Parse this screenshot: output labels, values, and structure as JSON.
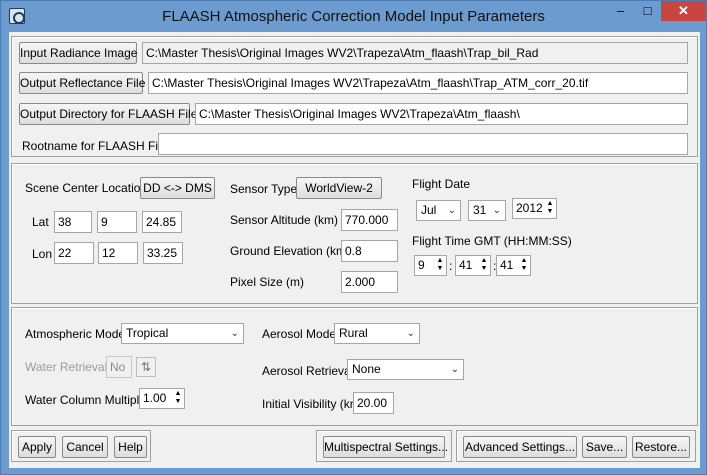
{
  "window": {
    "title": "FLAASH Atmospheric Correction Model Input Parameters",
    "minimize": "–",
    "maximize": "□",
    "close": "✕"
  },
  "files": {
    "input_radiance_label": "Input Radiance Image",
    "input_radiance_value": "C:\\Master Thesis\\Original Images WV2\\Trapeza\\Atm_flaash\\Trap_bil_Rad",
    "output_reflectance_label": "Output Reflectance File",
    "output_reflectance_value": "C:\\Master Thesis\\Original Images WV2\\Trapeza\\Atm_flaash\\Trap_ATM_corr_20.tif",
    "output_directory_label": "Output Directory for FLAASH Files",
    "output_directory_value": "C:\\Master Thesis\\Original Images WV2\\Trapeza\\Atm_flaash\\",
    "rootname_label": "Rootname for FLAASH Files",
    "rootname_value": ""
  },
  "scene": {
    "center_label": "Scene Center Location",
    "dd_dms_button": "DD <-> DMS",
    "lat_label": "Lat",
    "lat_deg": "38",
    "lat_min": "9",
    "lat_sec": "24.85",
    "lon_label": "Lon",
    "lon_deg": "22",
    "lon_min": "12",
    "lon_sec": "33.25"
  },
  "sensor": {
    "type_label": "Sensor Type",
    "type_value": "WorldView-2",
    "altitude_label": "Sensor Altitude (km)",
    "altitude_value": "770.000",
    "ground_elev_label": "Ground Elevation (km)",
    "ground_elev_value": "0.8",
    "pixel_size_label": "Pixel Size (m)",
    "pixel_size_value": "2.000"
  },
  "flight": {
    "date_label": "Flight Date",
    "month": "Jul",
    "day": "31",
    "year": "2012",
    "time_label": "Flight Time GMT (HH:MM:SS)",
    "hh": "9",
    "mm": "41",
    "ss": "41",
    "sep": ":"
  },
  "atmosphere": {
    "model_label": "Atmospheric Model",
    "model_value": "Tropical",
    "water_retrieval_label": "Water Retrieval",
    "water_retrieval_value": "No",
    "water_column_label": "Water Column Multiplier",
    "water_column_value": "1.00",
    "aerosol_model_label": "Aerosol Model",
    "aerosol_model_value": "Rural",
    "aerosol_retrieval_label": "Aerosol Retrieval",
    "aerosol_retrieval_value": "None",
    "visibility_label": "Initial Visibility (km)",
    "visibility_value": "20.00"
  },
  "footer": {
    "apply": "Apply",
    "cancel": "Cancel",
    "help": "Help",
    "multispectral": "Multispectral Settings...",
    "advanced": "Advanced Settings...",
    "save": "Save...",
    "restore": "Restore..."
  },
  "glyphs": {
    "dropdown_arrow": "⌄",
    "spin_up": "▲",
    "spin_down": "▼",
    "toggle": "⇅"
  },
  "colors": {
    "titlebar": "#6b9bcf",
    "close_button": "#c7463f",
    "dialog_background": "#f0f0f0"
  }
}
